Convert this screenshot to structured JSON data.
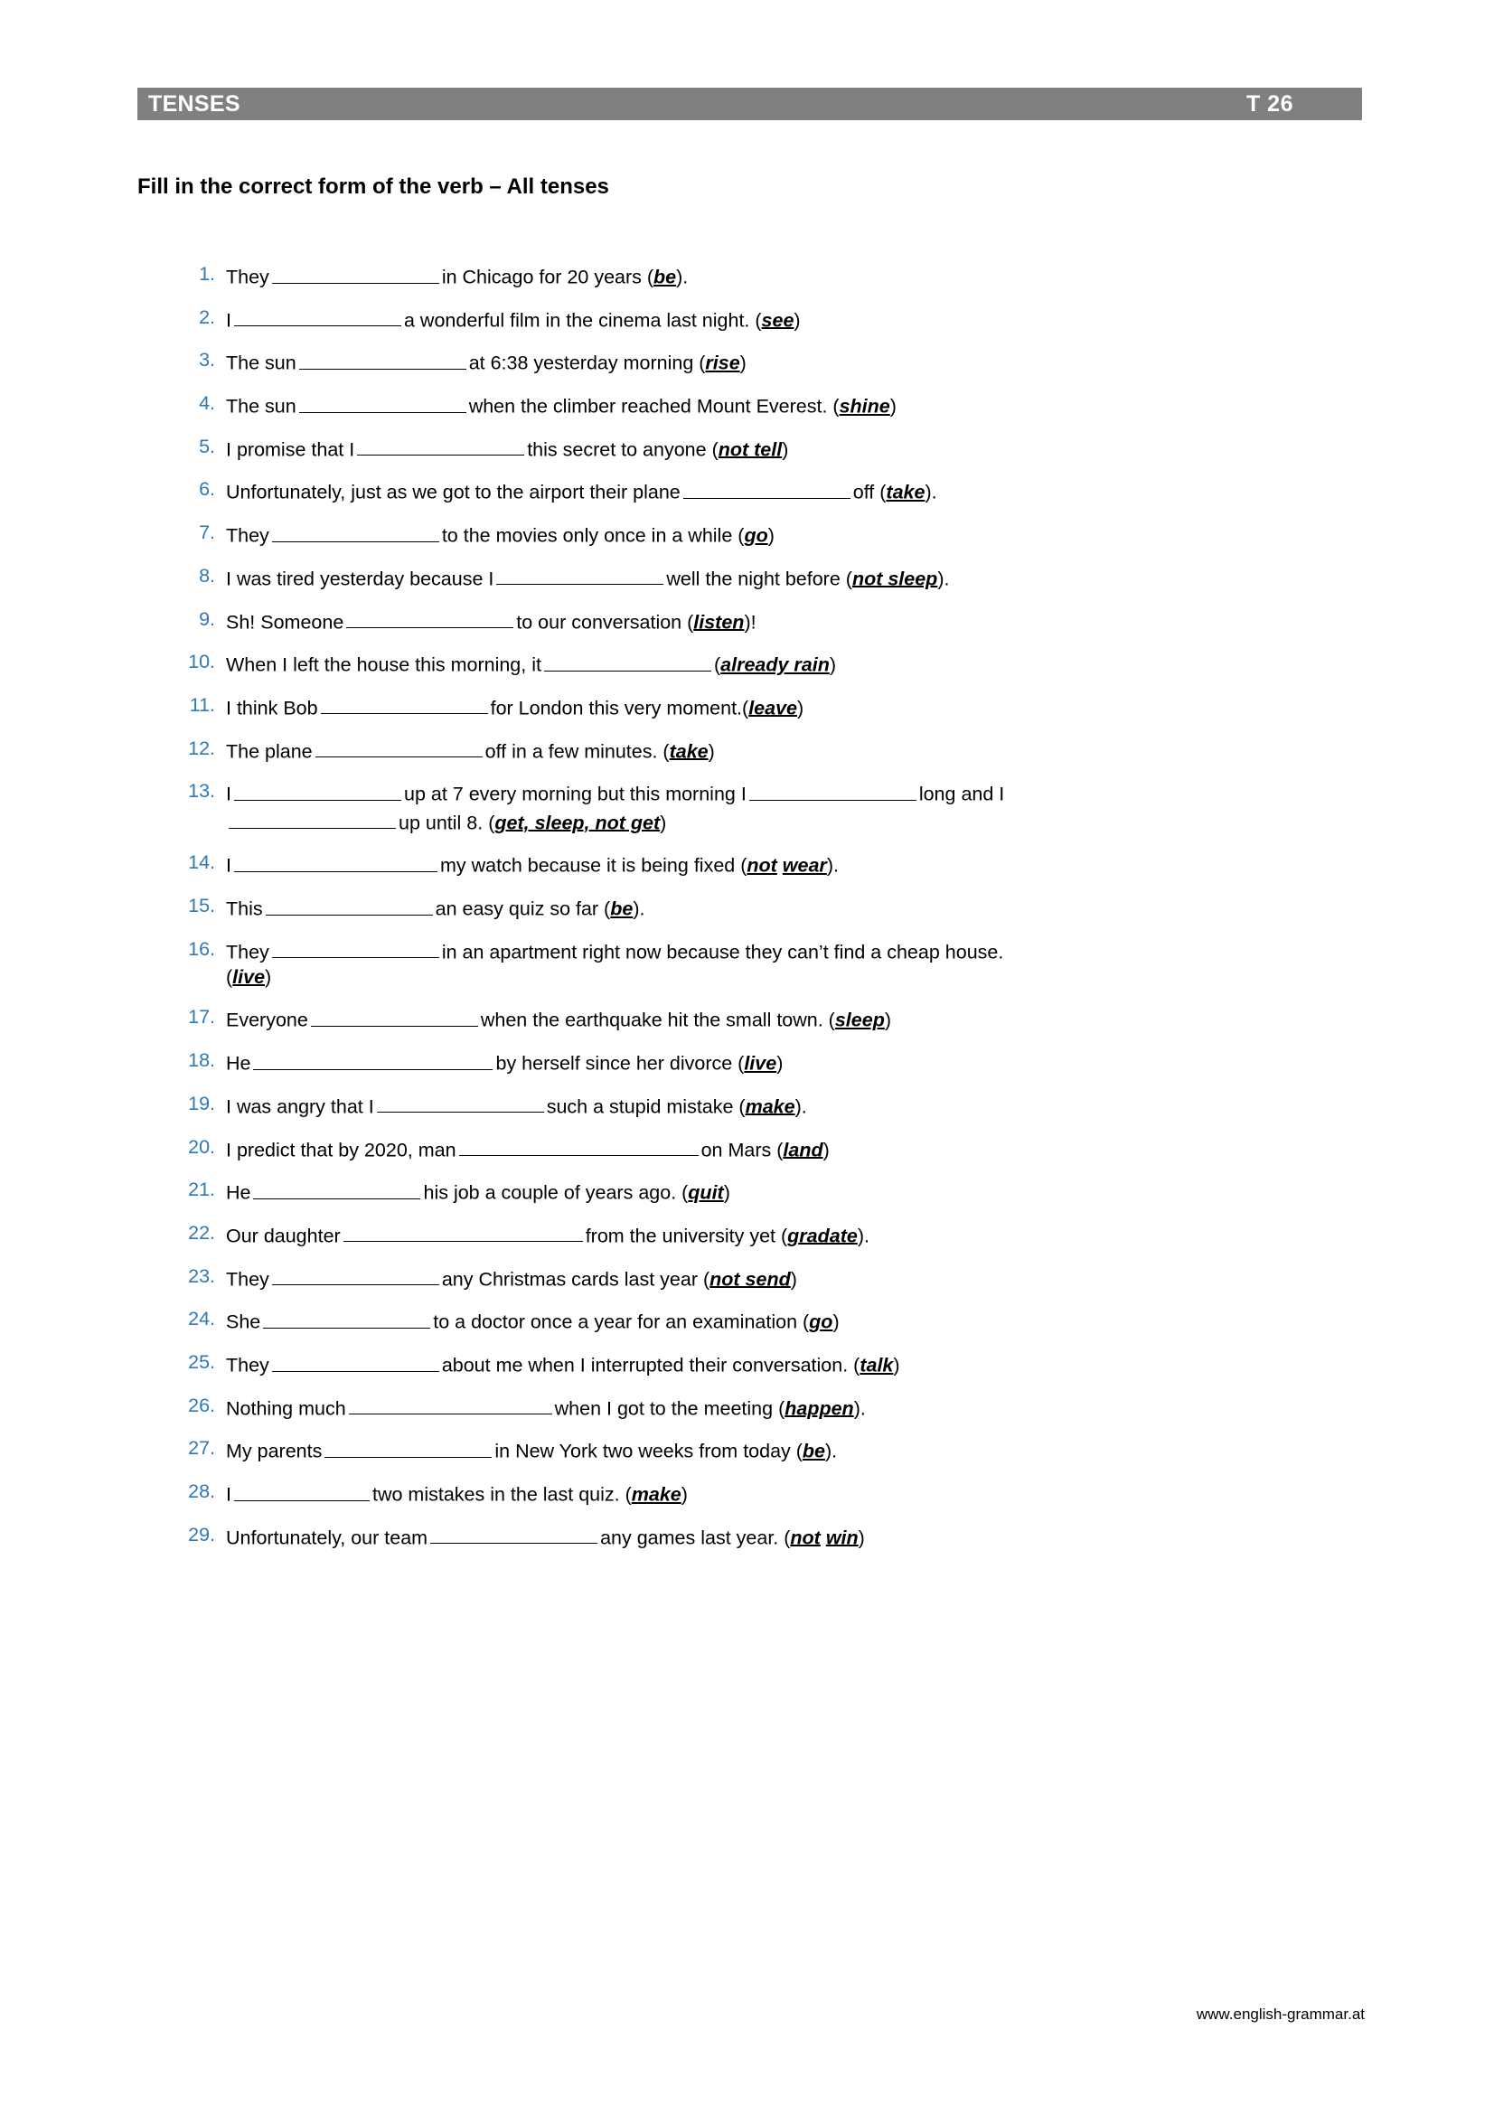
{
  "header": {
    "title": "TENSES",
    "code": "T  26"
  },
  "sheet_title": "Fill in the correct form of the verb – All tenses",
  "footer": {
    "url": "www.english-grammar.at"
  },
  "exercises": [
    {
      "number": "1.",
      "pre": "They",
      "post": "in Chicago for 20 years (",
      "cue": "be",
      "tail": ")."
    },
    {
      "number": "2.",
      "pre": "I",
      "post": "a wonderful film in the cinema last night. (",
      "cue": "see",
      "tail": ")"
    },
    {
      "number": "3.",
      "pre": "The sun",
      "post": "at 6:38 yesterday morning (",
      "cue": "rise",
      "tail": ")"
    },
    {
      "number": "4.",
      "pre": "The sun",
      "post": "when the climber reached Mount Everest. (",
      "cue": "shine",
      "tail": ")"
    },
    {
      "number": "5.",
      "pre": "I promise that I",
      "post": "this secret to anyone (",
      "cue": "not tell",
      "tail": ")"
    },
    {
      "number": "6.",
      "pre": "Unfortunately, just as we got to the airport their plane",
      "post": "off (",
      "cue": "take",
      "tail": ")."
    },
    {
      "number": "7.",
      "pre": "They",
      "post": "to the movies only once in a while (",
      "cue": "go",
      "tail": ")"
    },
    {
      "number": "8.",
      "pre": "I was tired yesterday because I",
      "post": "well the night before (",
      "cue": "not sleep",
      "tail": ")."
    },
    {
      "number": "9.",
      "pre": "Sh! Someone",
      "post": "to our conversation (",
      "cue": "listen",
      "tail": ")!"
    },
    {
      "number": "10.",
      "pre": "When I left the house this morning, it",
      "post": "(",
      "cue": "already rain",
      "tail": ")"
    },
    {
      "number": "11.",
      "pre": "I think Bob",
      "post": "for London this very moment.(",
      "cue": "leave",
      "tail": ")"
    },
    {
      "number": "12.",
      "pre": "The plane",
      "post": "off in a few minutes. (",
      "cue": "take",
      "tail": ")"
    },
    {
      "number": "13.",
      "pre": "I",
      "mid": "up at 7 every morning but this morning I",
      "post": "long and I",
      "line2_post": "up until 8. (",
      "cue": "get, sleep, not get",
      "tail": ")"
    },
    {
      "number": "14.",
      "pre": "I",
      "post": "my watch because it is being fixed (",
      "cue": "not",
      "cue2": "wear",
      "tail": ")."
    },
    {
      "number": "15.",
      "pre": "This",
      "post": "an easy quiz so far (",
      "cue": "be",
      "tail": ")."
    },
    {
      "number": "16.",
      "pre": "They",
      "post": "in an apartment right now because they can’t find a cheap house.",
      "line2_pre": "(",
      "cue": "live",
      "tail": ")"
    },
    {
      "number": "17.",
      "pre": "Everyone",
      "post": "when the earthquake hit the small town. (",
      "cue": "sleep",
      "tail": ")"
    },
    {
      "number": "18.",
      "pre": "He",
      "post": "by herself since her divorce (",
      "cue": "live",
      "tail": ")"
    },
    {
      "number": "19.",
      "pre": "I was angry that I",
      "post": "such a stupid mistake (",
      "cue": "make",
      "tail": ")."
    },
    {
      "number": "20.",
      "pre": "I predict that by 2020, man",
      "post": "on Mars (",
      "cue": "land",
      "tail": ")"
    },
    {
      "number": "21.",
      "pre": "He",
      "post": "his job a couple of years ago. (",
      "cue": "quit",
      "tail": ")"
    },
    {
      "number": "22.",
      "pre": "Our daughter",
      "post": "from the university yet (",
      "cue": "gradate",
      "tail": ")."
    },
    {
      "number": "23.",
      "pre": "They",
      "post": "any Christmas cards last year (",
      "cue": "not send",
      "tail": ")"
    },
    {
      "number": "24.",
      "pre": "She",
      "post": "to a doctor once a year for an examination (",
      "cue": "go",
      "tail": ")"
    },
    {
      "number": "25.",
      "pre": "They",
      "post": "about me when I interrupted their conversation. (",
      "cue": "talk",
      "tail": ")"
    },
    {
      "number": "26.",
      "pre": "Nothing much",
      "post": "when I got to the meeting (",
      "cue": "happen",
      "tail": ")."
    },
    {
      "number": "27.",
      "pre": "My parents",
      "post": "in New York two weeks from today (",
      "cue": "be",
      "tail": ")."
    },
    {
      "number": "28.",
      "pre": "I",
      "post": "two mistakes in the last quiz. (",
      "cue": "make",
      "tail": ")"
    },
    {
      "number": "29.",
      "pre": "Unfortunately, our team",
      "post": "any games last year. (",
      "cue": "not",
      "cue2": "win",
      "tail": ")"
    }
  ]
}
